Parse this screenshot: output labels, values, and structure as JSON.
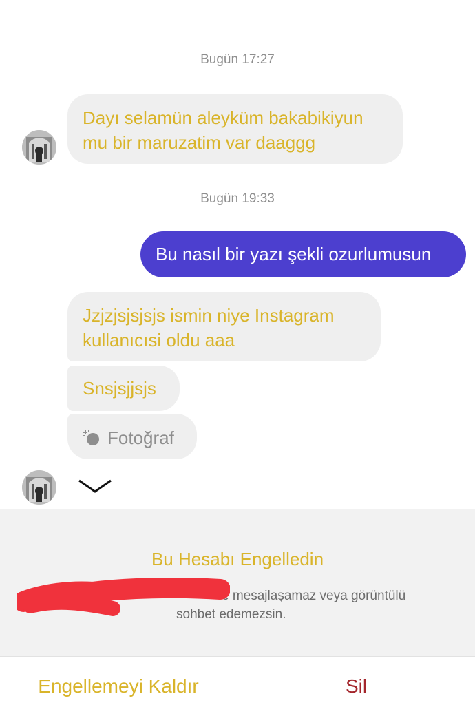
{
  "chat": {
    "timestamp_1": "Bugün 17:27",
    "timestamp_2": "Bugün 19:33",
    "incoming_1": [
      "Dayı selamün aleyküm bakabikiyun",
      "mu bir maruzatim var daaggg"
    ],
    "outgoing_1": "Bu nasıl bir yazı şekli ozurlumusun",
    "incoming_2": [
      "Jzjzjsjsjsjs ismin niye Instagram",
      "kullanıcısi oldu aaa"
    ],
    "incoming_3": "Snsjsjjsjs",
    "incoming_4": {
      "icon": "photo-icon",
      "label": "Fotoğraf"
    }
  },
  "block_notice": {
    "title": "Bu Hesabı Engelledin",
    "description_visible": "e mesajlaşamaz veya görüntülü",
    "description_line2": "sohbet edemezsin."
  },
  "actions": {
    "unblock_label": "Engellemeyi Kaldır",
    "delete_label": "Sil"
  },
  "colors": {
    "incoming_text": "#d9b42a",
    "incoming_bg": "#efefef",
    "outgoing_bg": "#4c3fcf",
    "delete": "#a4262c",
    "redaction": "#f0323c"
  }
}
